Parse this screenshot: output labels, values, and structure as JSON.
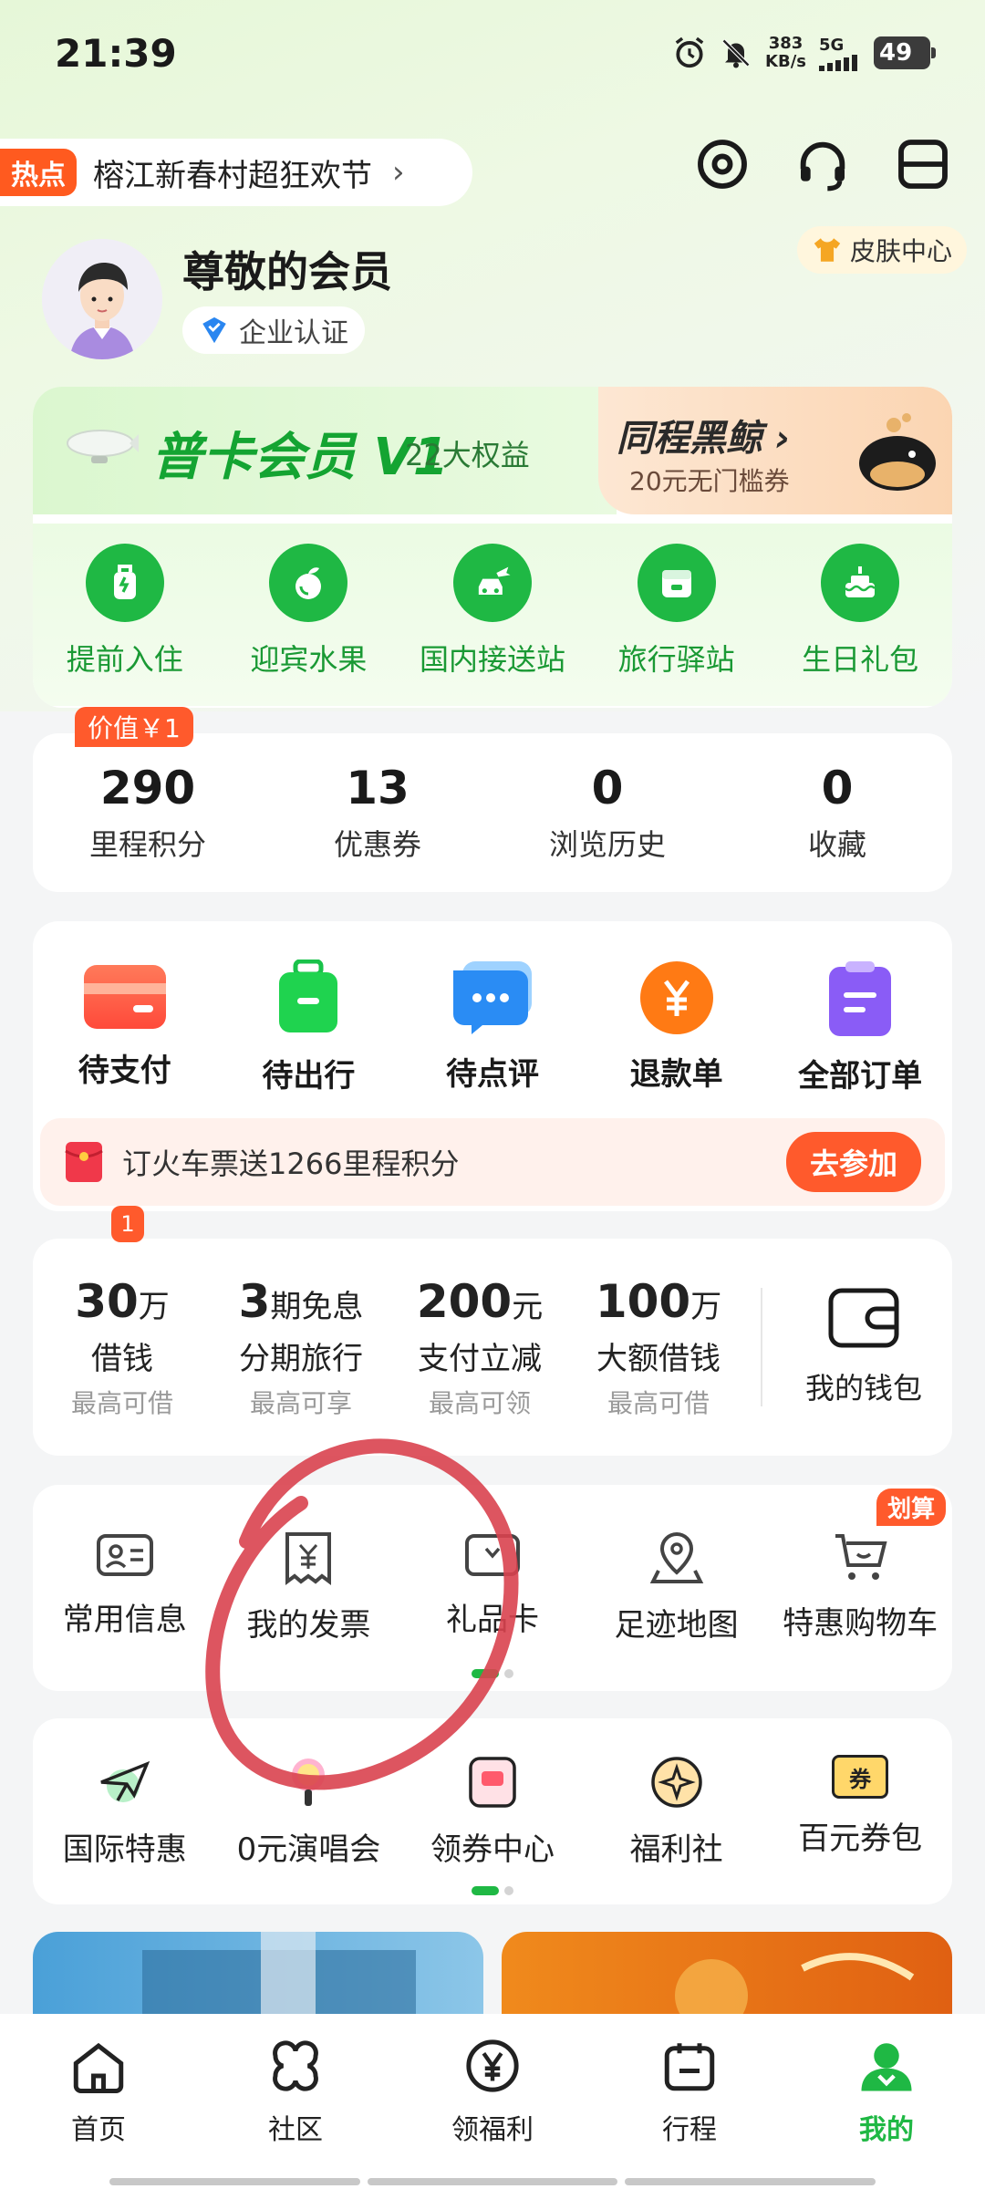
{
  "status_bar": {
    "time": "21:39",
    "net_speed_value": "383",
    "net_speed_unit": "KB/s",
    "network": "5G",
    "battery": "49"
  },
  "hot": {
    "badge": "热点",
    "text": "榕江新春村超狂欢节"
  },
  "header": {
    "skin_center": "皮肤中心"
  },
  "user": {
    "name": "尊敬的会员",
    "cert": "企业认证"
  },
  "vip": {
    "title": "普卡会员 V1",
    "benefits": "22大权益",
    "whale_title": "同程黑鲸 ›",
    "whale_sub": "20元无门槛券",
    "items": [
      {
        "label": "提前入住",
        "icon": "luggage-icon"
      },
      {
        "label": "迎宾水果",
        "icon": "fruit-icon"
      },
      {
        "label": "国内接送站",
        "icon": "car-plane-icon"
      },
      {
        "label": "旅行驿站",
        "icon": "station-icon"
      },
      {
        "label": "生日礼包",
        "icon": "cake-icon"
      }
    ]
  },
  "stats": {
    "badge": "价值￥1",
    "items": [
      {
        "num": "290",
        "label": "里程积分"
      },
      {
        "num": "13",
        "label": "优惠券"
      },
      {
        "num": "0",
        "label": "浏览历史"
      },
      {
        "num": "0",
        "label": "收藏"
      }
    ]
  },
  "orders": {
    "items": [
      {
        "label": "待支付"
      },
      {
        "label": "待出行"
      },
      {
        "label": "待点评"
      },
      {
        "label": "退款单"
      },
      {
        "label": "全部订单"
      }
    ],
    "promo_text": "订火车票送1266里程积分",
    "promo_button": "去参加"
  },
  "wallet": {
    "badge": "1",
    "items": [
      {
        "value": "30",
        "unit": "万",
        "title": "借钱",
        "sub": "最高可借"
      },
      {
        "value": "3",
        "unit": "期免息",
        "title": "分期旅行",
        "sub": "最高可享"
      },
      {
        "value": "200",
        "unit": "元",
        "title": "支付立减",
        "sub": "最高可领"
      },
      {
        "value": "100",
        "unit": "万",
        "title": "大额借钱",
        "sub": "最高可借"
      }
    ],
    "my_wallet": "我的钱包"
  },
  "tools": {
    "items": [
      {
        "label": "常用信息"
      },
      {
        "label": "我的发票"
      },
      {
        "label": "礼品卡"
      },
      {
        "label": "足迹地图"
      },
      {
        "label": "特惠购物车"
      }
    ],
    "cart_badge": "划算"
  },
  "tools2": {
    "items": [
      {
        "label": "国际特惠"
      },
      {
        "label": "0元演唱会"
      },
      {
        "label": "领券中心"
      },
      {
        "label": "福利社"
      },
      {
        "label": "百元券包"
      }
    ],
    "coupon_glyph": "券"
  },
  "tabbar": {
    "items": [
      {
        "label": "首页"
      },
      {
        "label": "社区"
      },
      {
        "label": "领福利"
      },
      {
        "label": "行程"
      },
      {
        "label": "我的"
      }
    ]
  },
  "colors": {
    "brand_green": "#1fb844",
    "accent_orange": "#ff5a2c",
    "annotation_red": "#d9434f"
  }
}
